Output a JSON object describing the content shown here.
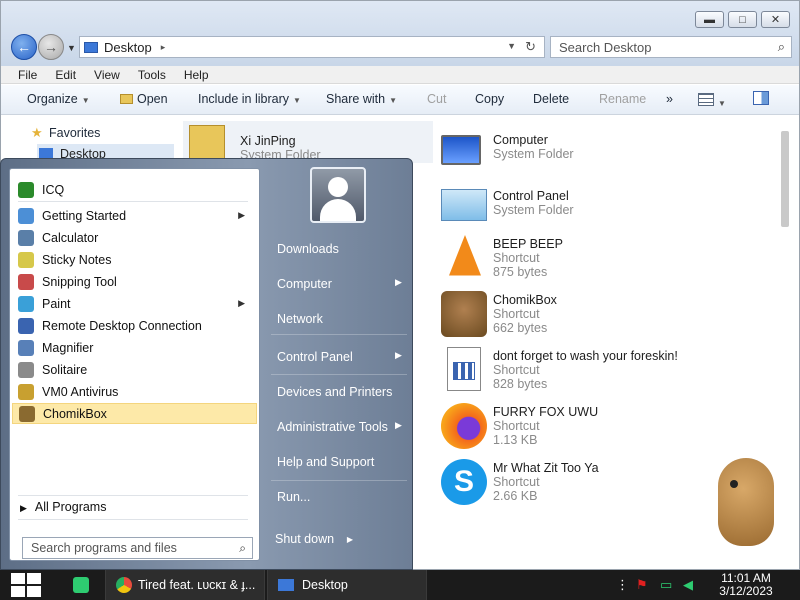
{
  "window": {
    "title_controls": {
      "minimize": "▬",
      "maximize": "□",
      "close": "✕"
    },
    "address": {
      "location": "Desktop",
      "separator": "▸"
    },
    "search": {
      "placeholder": "Search Desktop"
    },
    "menu": [
      "File",
      "Edit",
      "View",
      "Tools",
      "Help"
    ],
    "commands": {
      "organize": "Organize",
      "open": "Open",
      "include": "Include in library",
      "share": "Share with",
      "cut": "Cut",
      "copy": "Copy",
      "delete": "Delete",
      "rename": "Rename",
      "more": "»"
    },
    "nav": {
      "favorites": "Favorites",
      "desktop": "Desktop"
    },
    "items": [
      {
        "name": "Xi JinPing",
        "type": "System Folder",
        "size": ""
      },
      {
        "name": "Computer",
        "type": "System Folder",
        "size": ""
      },
      {
        "name": "Control Panel",
        "type": "System Folder",
        "size": ""
      },
      {
        "name": "BEEP BEEP",
        "type": "Shortcut",
        "size": "875 bytes"
      },
      {
        "name": "ChomikBox",
        "type": "Shortcut",
        "size": "662 bytes"
      },
      {
        "name": "dont forget to wash your foreskin!",
        "type": "Shortcut",
        "size": "828 bytes"
      },
      {
        "name": "FURRY FOX UWU",
        "type": "Shortcut",
        "size": "1.13 KB"
      },
      {
        "name": "Mr What Zit Too Ya",
        "type": "Shortcut",
        "size": "2.66 KB"
      }
    ]
  },
  "start_menu": {
    "pinned": [
      {
        "label": "ICQ",
        "icon": "icq-icon",
        "color": "#2b8a2b",
        "has_submenu": false
      },
      {
        "label": "Getting Started",
        "icon": "getting-started-icon",
        "color": "#4c8fd6",
        "has_submenu": true
      },
      {
        "label": "Calculator",
        "icon": "calculator-icon",
        "color": "#5a7fa8",
        "has_submenu": false
      },
      {
        "label": "Sticky Notes",
        "icon": "sticky-notes-icon",
        "color": "#d6c84a",
        "has_submenu": false
      },
      {
        "label": "Snipping Tool",
        "icon": "snipping-tool-icon",
        "color": "#c84a4a",
        "has_submenu": false
      },
      {
        "label": "Paint",
        "icon": "paint-icon",
        "color": "#3aa0d8",
        "has_submenu": true
      },
      {
        "label": "Remote Desktop Connection",
        "icon": "remote-desktop-icon",
        "color": "#3a64b0",
        "has_submenu": false
      },
      {
        "label": "Magnifier",
        "icon": "magnifier-icon",
        "color": "#5880b8",
        "has_submenu": false
      },
      {
        "label": "Solitaire",
        "icon": "solitaire-icon",
        "color": "#8a8a8a",
        "has_submenu": false
      },
      {
        "label": "VM0 Antivirus",
        "icon": "shield-icon",
        "color": "#c8a030",
        "has_submenu": false
      },
      {
        "label": "ChomikBox",
        "icon": "chomikbox-icon",
        "color": "#8a6a30",
        "has_submenu": false
      }
    ],
    "all_programs": "All Programs",
    "search_placeholder": "Search programs and files",
    "right_links": [
      {
        "label": "Downloads",
        "has_submenu": false
      },
      {
        "label": "Computer",
        "has_submenu": true
      },
      {
        "label": "Network",
        "has_submenu": false
      },
      {
        "label": "Control Panel",
        "has_submenu": true
      },
      {
        "label": "Devices and Printers",
        "has_submenu": false
      },
      {
        "label": "Administrative Tools",
        "has_submenu": true
      },
      {
        "label": "Help and Support",
        "has_submenu": false
      },
      {
        "label": "Run...",
        "has_submenu": false
      }
    ],
    "shutdown": "Shut down",
    "submenu_arrow": "▶"
  },
  "taskbar": {
    "apps": [
      {
        "label": "",
        "icon": "chat-app-icon"
      },
      {
        "label": "Tired feat. ʟᴜᴄᴋɪ & ɟ...",
        "icon": "chrome-icon"
      },
      {
        "label": "Desktop",
        "icon": "explorer-icon"
      }
    ],
    "clock": {
      "time": "11:01 AM",
      "date": "3/12/2023"
    }
  }
}
